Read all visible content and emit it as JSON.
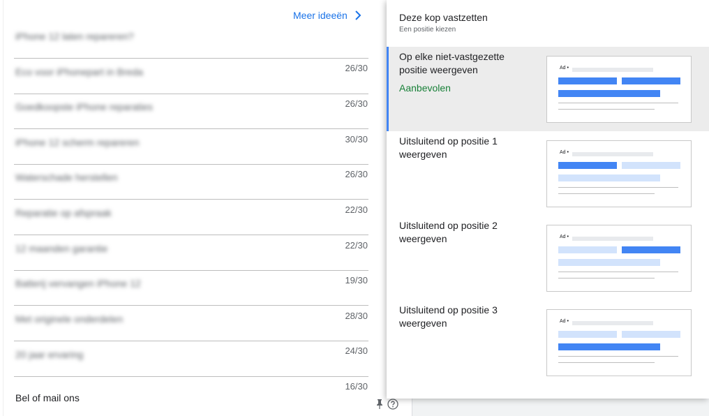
{
  "left": {
    "more_ideas_label": "Meer ideeën",
    "rows": [
      {
        "text": "iPhone 12 laten repareren?",
        "count": "26/30"
      },
      {
        "text": "Eco voor iPhonepart in Breda",
        "count": "26/30"
      },
      {
        "text": "Goedkoopste iPhone reparaties",
        "count": "30/30"
      },
      {
        "text": "iPhone 12 scherm repareren",
        "count": "26/30"
      },
      {
        "text": "Waterschade herstellen",
        "count": "22/30"
      },
      {
        "text": "Reparatie op afspraak",
        "count": "22/30"
      },
      {
        "text": "12 maanden garantie",
        "count": "19/30"
      },
      {
        "text": "Batterij vervangen iPhone 12",
        "count": "28/30"
      },
      {
        "text": "Met originele onderdelen",
        "count": "24/30"
      },
      {
        "text": "20 jaar ervaring",
        "count": "16/30"
      }
    ],
    "last_row_text": "Bel of mail ons"
  },
  "panel": {
    "title": "Deze kop vastzetten",
    "subtitle": "Een positie kiezen",
    "options": [
      {
        "label": "Op elke niet-vastgezette positie weergeven",
        "badge": "Aanbevolen",
        "selected": true
      },
      {
        "label": "Uitsluitend op positie 1 weergeven",
        "selected": false
      },
      {
        "label": "Uitsluitend op positie 2 weergeven",
        "selected": false
      },
      {
        "label": "Uitsluitend op positie 3 weergeven",
        "selected": false
      }
    ],
    "thumb_ad_label": "Ad"
  },
  "colors": {
    "accent_blue": "#4285f4",
    "light_blue": "#d2e3fc",
    "recommended_green": "#188038",
    "link_blue": "#1a73e8"
  },
  "icons": {
    "more_ideas": "chevron-right-icon",
    "pin": "pin-icon",
    "help": "help-circle-icon"
  }
}
